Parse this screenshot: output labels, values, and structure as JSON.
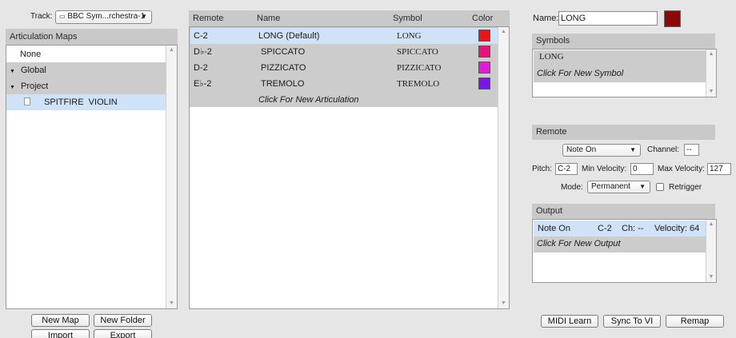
{
  "top": {
    "track_label": "Track:",
    "track_value": "BBC Sym...rchestra-1"
  },
  "maps": {
    "header": "Articulation Maps",
    "items": [
      {
        "label": "None"
      },
      {
        "label": "Global"
      },
      {
        "label": "Project"
      },
      {
        "label": "SPITFIRE  VIOLIN"
      }
    ],
    "buttons": {
      "new_map": "New Map",
      "new_folder": "New Folder",
      "import": "Import",
      "export": "Export"
    }
  },
  "articulations": {
    "columns": {
      "remote": "Remote",
      "name": "Name",
      "symbol": "Symbol",
      "color": "Color"
    },
    "rows": [
      {
        "remote": "C-2",
        "name": "LONG (Default)",
        "symbol": "LONG",
        "color": "#e8141a"
      },
      {
        "remote": "D♭-2",
        "name": "SPICCATO",
        "symbol": "SPICCATO",
        "color": "#e8127a"
      },
      {
        "remote": "D-2",
        "name": "PIZZICATO",
        "symbol": "PIZZICATO",
        "color": "#e21ad8"
      },
      {
        "remote": "E♭-2",
        "name": "TREMOLO",
        "symbol": "TREMOLO",
        "color": "#7a17e6"
      }
    ],
    "new_row": "Click For New Articulation"
  },
  "inspector": {
    "name_label": "Name:",
    "name_value": "LONG",
    "name_color": "#8a0a0a",
    "symbols_header": "Symbols",
    "symbol_value": "LONG",
    "new_symbol": "Click For New Symbol",
    "remote_header": "Remote",
    "remote_type": "Note On",
    "channel_label": "Channel:",
    "channel_value": "--",
    "pitch_label": "Pitch:",
    "pitch_value": "C-2",
    "min_vel_label": "Min Velocity:",
    "min_vel_value": "0",
    "max_vel_label": "Max Velocity:",
    "max_vel_value": "127",
    "mode_label": "Mode:",
    "mode_value": "Permanent",
    "retrigger_label": "Retrigger",
    "output_header": "Output",
    "output_type": "Note On",
    "output_pitch": "C-2",
    "output_channel": "Ch: --",
    "output_velocity": "Velocity: 64",
    "new_output": "Click For New Output"
  },
  "bottom_buttons": {
    "midi_learn": "MIDI Learn",
    "sync": "Sync To VI",
    "remap": "Remap"
  },
  "colors": {
    "selected_row": "#cfe2f8",
    "header_gray": "#c9c9c9",
    "panel_gray": "#cccccc"
  }
}
